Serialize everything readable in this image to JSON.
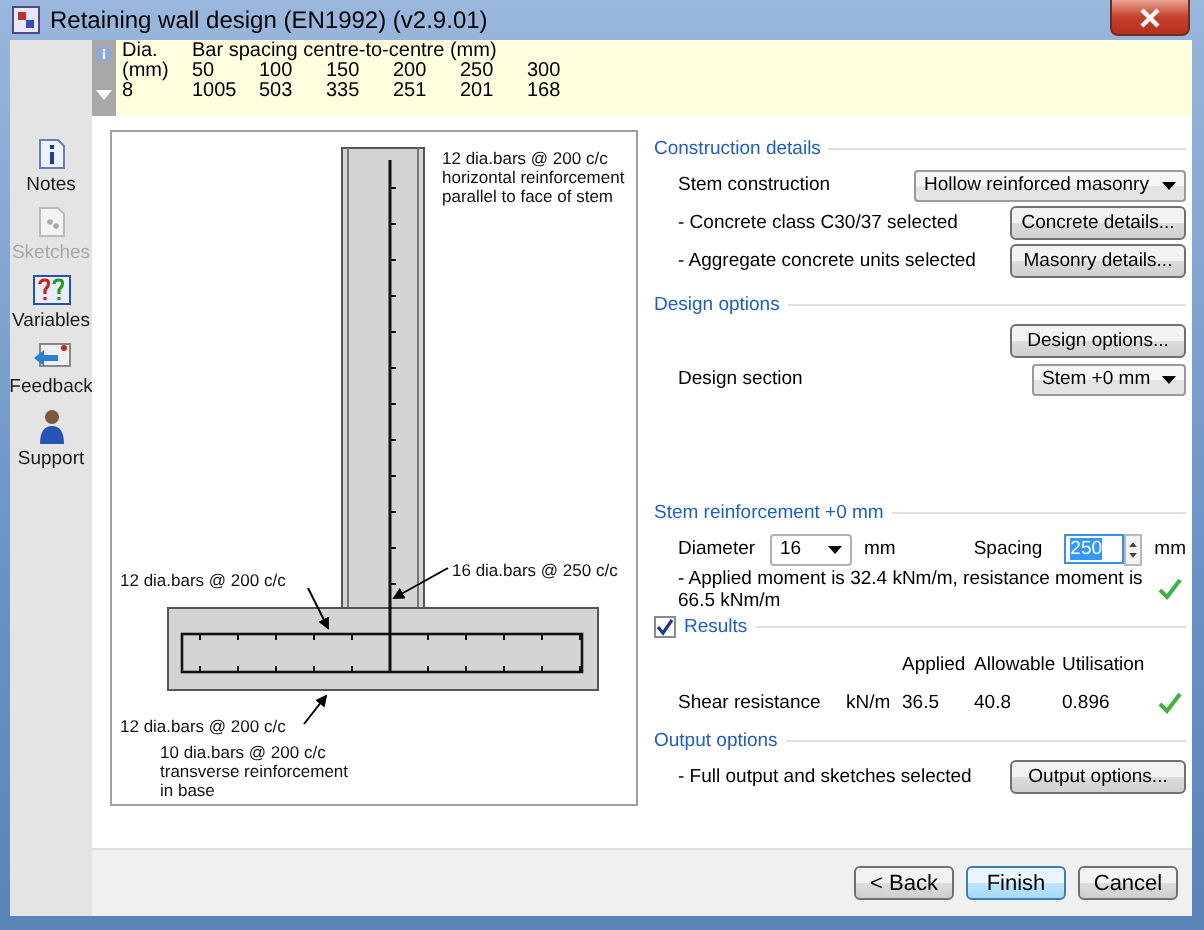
{
  "window": {
    "title": "Retaining wall design (EN1992) (v2.9.01)"
  },
  "sidebar": {
    "items": [
      {
        "label": "Notes",
        "disabled": false
      },
      {
        "label": "Sketches",
        "disabled": true
      },
      {
        "label": "Variables",
        "disabled": false
      },
      {
        "label": "Feedback",
        "disabled": false
      },
      {
        "label": "Support",
        "disabled": false
      }
    ]
  },
  "info_table": {
    "header": [
      "Dia.",
      "Bar spacing centre-to-centre (mm)"
    ],
    "rows": [
      [
        "(mm)",
        "50",
        "100",
        "150",
        "200",
        "250",
        "300"
      ],
      [
        "8",
        "1005",
        "503",
        "335",
        "251",
        "201",
        "168"
      ]
    ]
  },
  "drawing": {
    "labels": [
      {
        "lines": [
          "12 dia.bars @ 200 c/c",
          "horizontal reinforcement",
          "parallel to face of stem"
        ]
      },
      {
        "lines": [
          "16 dia.bars @ 250 c/c"
        ]
      },
      {
        "lines": [
          "12 dia.bars @ 200 c/c"
        ]
      },
      {
        "lines": [
          "12 dia.bars @ 200 c/c"
        ]
      },
      {
        "lines": [
          "10 dia.bars @ 200 c/c",
          "transverse reinforcement",
          "in base"
        ]
      }
    ]
  },
  "construction_details": {
    "title": "Construction details",
    "stem_construction": {
      "label": "Stem construction",
      "value": "Hollow reinforced masonry"
    },
    "notes": [
      {
        "text": "- Concrete class C30/37 selected",
        "button": "Concrete details..."
      },
      {
        "text": "- Aggregate concrete units selected",
        "button": "Masonry details..."
      }
    ]
  },
  "design_options": {
    "title": "Design options",
    "button": "Design options...",
    "design_section": {
      "label": "Design section",
      "value": "Stem +0 mm"
    }
  },
  "stem_reinforcement": {
    "title": "Stem reinforcement +0 mm",
    "diameter": {
      "label": "Diameter",
      "value": "16",
      "unit": "mm"
    },
    "spacing": {
      "label": "Spacing",
      "value": "250",
      "unit": "mm",
      "selected": true
    },
    "message": "- Applied moment is 32.4 kNm/m, resistance moment is 66.5 kNm/m",
    "ok": true
  },
  "results": {
    "title": "Results",
    "checked": true,
    "columns": [
      "Applied",
      "Allowable",
      "Utilisation"
    ],
    "rows": [
      {
        "name": "Shear resistance",
        "unit": "kN/m",
        "applied": "36.5",
        "allowable": "40.8",
        "utilisation": "0.896",
        "ok": true
      }
    ]
  },
  "output_options": {
    "title": "Output options",
    "note": "- Full output and sketches selected",
    "button": "Output options..."
  },
  "footer": {
    "buttons": [
      {
        "label": "< Back",
        "default": false
      },
      {
        "label": "Finish",
        "default": true
      },
      {
        "label": "Cancel",
        "default": false
      }
    ]
  }
}
